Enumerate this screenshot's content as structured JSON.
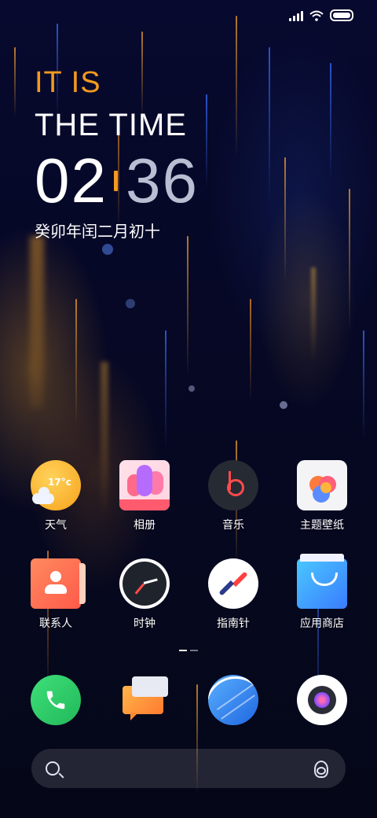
{
  "statusbar": {
    "signal": "signal-icon",
    "wifi": "wifi-icon",
    "battery": "battery-icon"
  },
  "widget": {
    "line1": "IT IS",
    "line2": "THE TIME",
    "hour": "02",
    "minute": "36",
    "lunar_date": "癸卯年闰二月初十"
  },
  "apps": {
    "row1": [
      {
        "label": "天气",
        "icon": "weather-icon",
        "badge": "17°c"
      },
      {
        "label": "相册",
        "icon": "gallery-icon"
      },
      {
        "label": "音乐",
        "icon": "music-icon"
      },
      {
        "label": "主题壁纸",
        "icon": "theme-icon"
      }
    ],
    "row2": [
      {
        "label": "联系人",
        "icon": "contacts-icon"
      },
      {
        "label": "时钟",
        "icon": "clock-icon"
      },
      {
        "label": "指南针",
        "icon": "compass-icon"
      },
      {
        "label": "应用商店",
        "icon": "app-store-icon"
      }
    ]
  },
  "dock": [
    {
      "icon": "phone-icon"
    },
    {
      "icon": "messages-icon"
    },
    {
      "icon": "browser-icon"
    },
    {
      "icon": "camera-icon"
    }
  ],
  "search": {
    "left_icon": "search-icon",
    "right_icon": "assistant-icon"
  },
  "colors": {
    "accent": "#f39a1e",
    "background": "#06092a"
  }
}
